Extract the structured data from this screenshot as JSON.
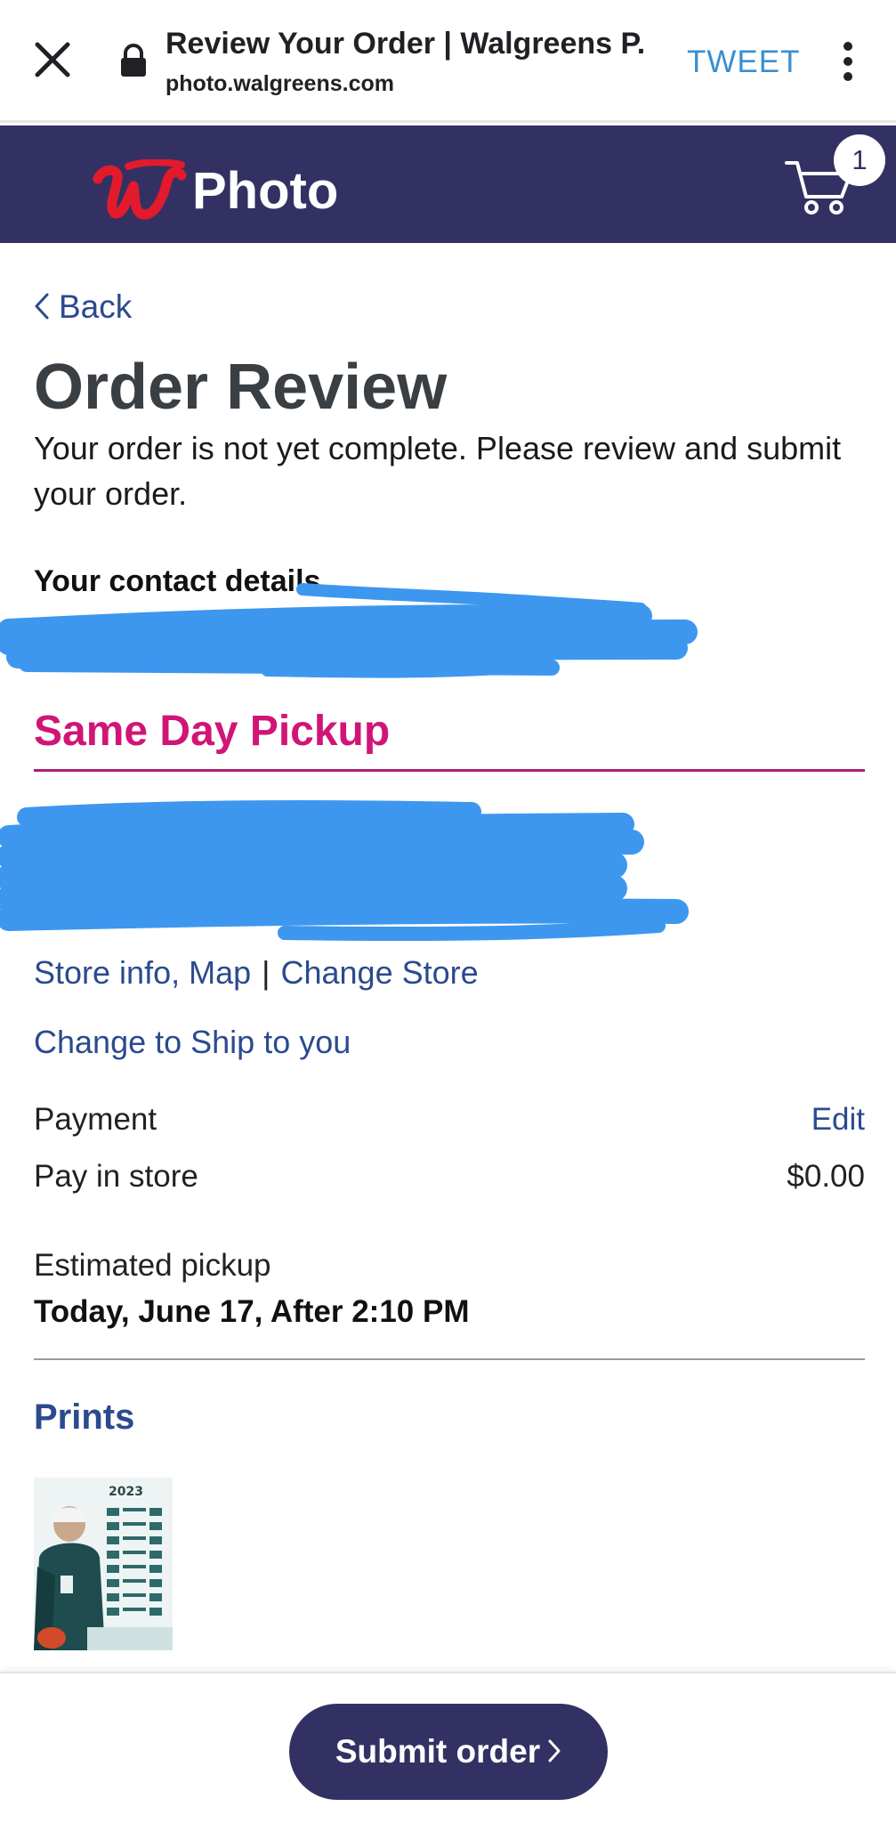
{
  "browser": {
    "page_title": "Review Your Order | Walgreens P...",
    "domain": "photo.walgreens.com",
    "tweet_label": "TWEET"
  },
  "header": {
    "logo_text": "Photo",
    "cart_count": "1",
    "bg_color": "#333163",
    "logo_color": "#e31a2b"
  },
  "nav": {
    "back_label": "Back"
  },
  "page": {
    "title": "Order Review",
    "intro": "Your order is not yet complete. Please review and submit your order."
  },
  "contact": {
    "heading": "Your contact details"
  },
  "pickup": {
    "title": "Same Day Pickup",
    "title_color": "#d11576",
    "store_info_link": "Store info, Map",
    "separator": "|",
    "change_store_link": "Change Store",
    "ship_link": "Change to Ship to you"
  },
  "payment": {
    "label": "Payment",
    "edit_label": "Edit",
    "method": "Pay in store",
    "amount": "$0.00"
  },
  "estimate": {
    "label": "Estimated pickup",
    "value": "Today, June 17, After 2:10 PM"
  },
  "prints": {
    "title": "Prints"
  },
  "footer": {
    "submit_label": "Submit order"
  },
  "icons": {
    "close": "close-icon",
    "lock": "lock-icon",
    "more": "more-vertical-icon",
    "cart": "cart-icon",
    "back": "chevron-left-icon",
    "submit": "chevron-right-icon"
  },
  "redaction_color": "#3d97ef"
}
